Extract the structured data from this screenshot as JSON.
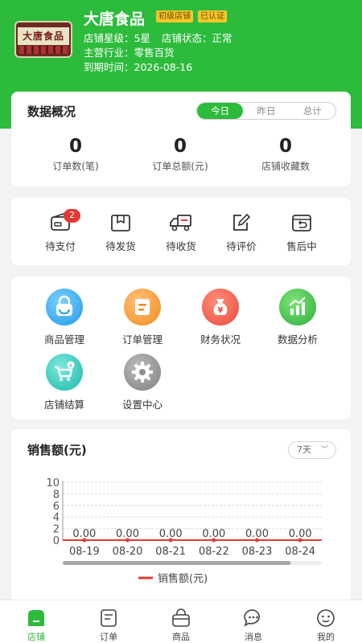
{
  "shop": {
    "name": "大唐食品",
    "logo_text": "大唐食品",
    "badges": [
      "初级店铺",
      "已认证"
    ],
    "rating_label": "店铺星级：",
    "rating_value": "5星",
    "status_label": "店铺状态：",
    "status_value": "正常",
    "industry_label": "主营行业：",
    "industry_value": "零售百货",
    "expiry_label": "到期时间：",
    "expiry_value": "2026-08-16"
  },
  "overview": {
    "title": "数据概况",
    "periods": [
      "今日",
      "昨日",
      "总计"
    ],
    "active_period": "今日",
    "stats": [
      {
        "value": "0",
        "label": "订单数(笔)"
      },
      {
        "value": "0",
        "label": "订单总额(元)"
      },
      {
        "value": "0",
        "label": "店铺收藏数"
      }
    ]
  },
  "orders": [
    {
      "label": "待支付",
      "icon": "wallet-icon",
      "count": "2"
    },
    {
      "label": "待发货",
      "icon": "package-icon"
    },
    {
      "label": "待收货",
      "icon": "truck-icon"
    },
    {
      "label": "待评价",
      "icon": "pencil-note-icon"
    },
    {
      "label": "售后中",
      "icon": "return-box-icon"
    }
  ],
  "tools": [
    {
      "label": "商品管理",
      "icon": "shopping-bag-icon",
      "color": "#1e9ae8"
    },
    {
      "label": "订单管理",
      "icon": "order-document-icon",
      "color": "#f28a1c"
    },
    {
      "label": "财务状况",
      "icon": "money-bag-icon",
      "color": "#e8483a"
    },
    {
      "label": "数据分析",
      "icon": "bar-chart-icon",
      "color": "#2cb03b"
    },
    {
      "label": "店铺结算",
      "icon": "cart-coin-icon",
      "color": "#18b8a8"
    },
    {
      "label": "设置中心",
      "icon": "gear-icon",
      "color": "#7e7e7e"
    }
  ],
  "sales": {
    "title": "销售额(元)",
    "range": "7天"
  },
  "chart_data": {
    "type": "line",
    "title": "销售额(元)",
    "x": [
      "08-19",
      "08-20",
      "08-21",
      "08-22",
      "08-23",
      "08-24"
    ],
    "series": [
      {
        "name": "销售额(元)",
        "values": [
          0.0,
          0.0,
          0.0,
          0.0,
          0.0,
          0.0
        ]
      }
    ],
    "data_labels": [
      "0.00",
      "0.00",
      "0.00",
      "0.00",
      "0.00",
      "0.00"
    ],
    "y_ticks": [
      "0",
      "2",
      "4",
      "6",
      "8",
      "10"
    ],
    "ylim": [
      0,
      10
    ],
    "grid": true,
    "legend": "bottom-center",
    "series_color": "#e53935"
  },
  "tabbar": [
    {
      "label": "店铺",
      "icon": "shop-icon",
      "active": true
    },
    {
      "label": "订单",
      "icon": "order-list-icon",
      "active": false
    },
    {
      "label": "商品",
      "icon": "goods-bag-icon",
      "active": false
    },
    {
      "label": "消息",
      "icon": "message-icon",
      "active": false
    },
    {
      "label": "我的",
      "icon": "profile-icon",
      "active": false
    }
  ],
  "colors": {
    "brand": "#2dbb3c",
    "badge": "#f3c52a",
    "alert": "#e53935"
  }
}
